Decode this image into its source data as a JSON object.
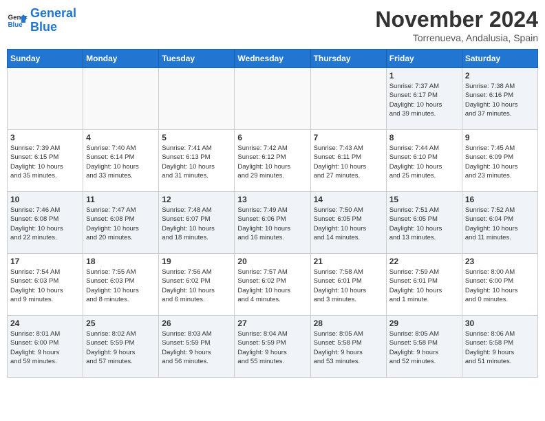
{
  "header": {
    "logo_line1": "General",
    "logo_line2": "Blue",
    "month_title": "November 2024",
    "subtitle": "Torrenueva, Andalusia, Spain"
  },
  "weekdays": [
    "Sunday",
    "Monday",
    "Tuesday",
    "Wednesday",
    "Thursday",
    "Friday",
    "Saturday"
  ],
  "weeks": [
    [
      {
        "day": "",
        "info": ""
      },
      {
        "day": "",
        "info": ""
      },
      {
        "day": "",
        "info": ""
      },
      {
        "day": "",
        "info": ""
      },
      {
        "day": "",
        "info": ""
      },
      {
        "day": "1",
        "info": "Sunrise: 7:37 AM\nSunset: 6:17 PM\nDaylight: 10 hours\nand 39 minutes."
      },
      {
        "day": "2",
        "info": "Sunrise: 7:38 AM\nSunset: 6:16 PM\nDaylight: 10 hours\nand 37 minutes."
      }
    ],
    [
      {
        "day": "3",
        "info": "Sunrise: 7:39 AM\nSunset: 6:15 PM\nDaylight: 10 hours\nand 35 minutes."
      },
      {
        "day": "4",
        "info": "Sunrise: 7:40 AM\nSunset: 6:14 PM\nDaylight: 10 hours\nand 33 minutes."
      },
      {
        "day": "5",
        "info": "Sunrise: 7:41 AM\nSunset: 6:13 PM\nDaylight: 10 hours\nand 31 minutes."
      },
      {
        "day": "6",
        "info": "Sunrise: 7:42 AM\nSunset: 6:12 PM\nDaylight: 10 hours\nand 29 minutes."
      },
      {
        "day": "7",
        "info": "Sunrise: 7:43 AM\nSunset: 6:11 PM\nDaylight: 10 hours\nand 27 minutes."
      },
      {
        "day": "8",
        "info": "Sunrise: 7:44 AM\nSunset: 6:10 PM\nDaylight: 10 hours\nand 25 minutes."
      },
      {
        "day": "9",
        "info": "Sunrise: 7:45 AM\nSunset: 6:09 PM\nDaylight: 10 hours\nand 23 minutes."
      }
    ],
    [
      {
        "day": "10",
        "info": "Sunrise: 7:46 AM\nSunset: 6:08 PM\nDaylight: 10 hours\nand 22 minutes."
      },
      {
        "day": "11",
        "info": "Sunrise: 7:47 AM\nSunset: 6:08 PM\nDaylight: 10 hours\nand 20 minutes."
      },
      {
        "day": "12",
        "info": "Sunrise: 7:48 AM\nSunset: 6:07 PM\nDaylight: 10 hours\nand 18 minutes."
      },
      {
        "day": "13",
        "info": "Sunrise: 7:49 AM\nSunset: 6:06 PM\nDaylight: 10 hours\nand 16 minutes."
      },
      {
        "day": "14",
        "info": "Sunrise: 7:50 AM\nSunset: 6:05 PM\nDaylight: 10 hours\nand 14 minutes."
      },
      {
        "day": "15",
        "info": "Sunrise: 7:51 AM\nSunset: 6:05 PM\nDaylight: 10 hours\nand 13 minutes."
      },
      {
        "day": "16",
        "info": "Sunrise: 7:52 AM\nSunset: 6:04 PM\nDaylight: 10 hours\nand 11 minutes."
      }
    ],
    [
      {
        "day": "17",
        "info": "Sunrise: 7:54 AM\nSunset: 6:03 PM\nDaylight: 10 hours\nand 9 minutes."
      },
      {
        "day": "18",
        "info": "Sunrise: 7:55 AM\nSunset: 6:03 PM\nDaylight: 10 hours\nand 8 minutes."
      },
      {
        "day": "19",
        "info": "Sunrise: 7:56 AM\nSunset: 6:02 PM\nDaylight: 10 hours\nand 6 minutes."
      },
      {
        "day": "20",
        "info": "Sunrise: 7:57 AM\nSunset: 6:02 PM\nDaylight: 10 hours\nand 4 minutes."
      },
      {
        "day": "21",
        "info": "Sunrise: 7:58 AM\nSunset: 6:01 PM\nDaylight: 10 hours\nand 3 minutes."
      },
      {
        "day": "22",
        "info": "Sunrise: 7:59 AM\nSunset: 6:01 PM\nDaylight: 10 hours\nand 1 minute."
      },
      {
        "day": "23",
        "info": "Sunrise: 8:00 AM\nSunset: 6:00 PM\nDaylight: 10 hours\nand 0 minutes."
      }
    ],
    [
      {
        "day": "24",
        "info": "Sunrise: 8:01 AM\nSunset: 6:00 PM\nDaylight: 9 hours\nand 59 minutes."
      },
      {
        "day": "25",
        "info": "Sunrise: 8:02 AM\nSunset: 5:59 PM\nDaylight: 9 hours\nand 57 minutes."
      },
      {
        "day": "26",
        "info": "Sunrise: 8:03 AM\nSunset: 5:59 PM\nDaylight: 9 hours\nand 56 minutes."
      },
      {
        "day": "27",
        "info": "Sunrise: 8:04 AM\nSunset: 5:59 PM\nDaylight: 9 hours\nand 55 minutes."
      },
      {
        "day": "28",
        "info": "Sunrise: 8:05 AM\nSunset: 5:58 PM\nDaylight: 9 hours\nand 53 minutes."
      },
      {
        "day": "29",
        "info": "Sunrise: 8:05 AM\nSunset: 5:58 PM\nDaylight: 9 hours\nand 52 minutes."
      },
      {
        "day": "30",
        "info": "Sunrise: 8:06 AM\nSunset: 5:58 PM\nDaylight: 9 hours\nand 51 minutes."
      }
    ]
  ]
}
